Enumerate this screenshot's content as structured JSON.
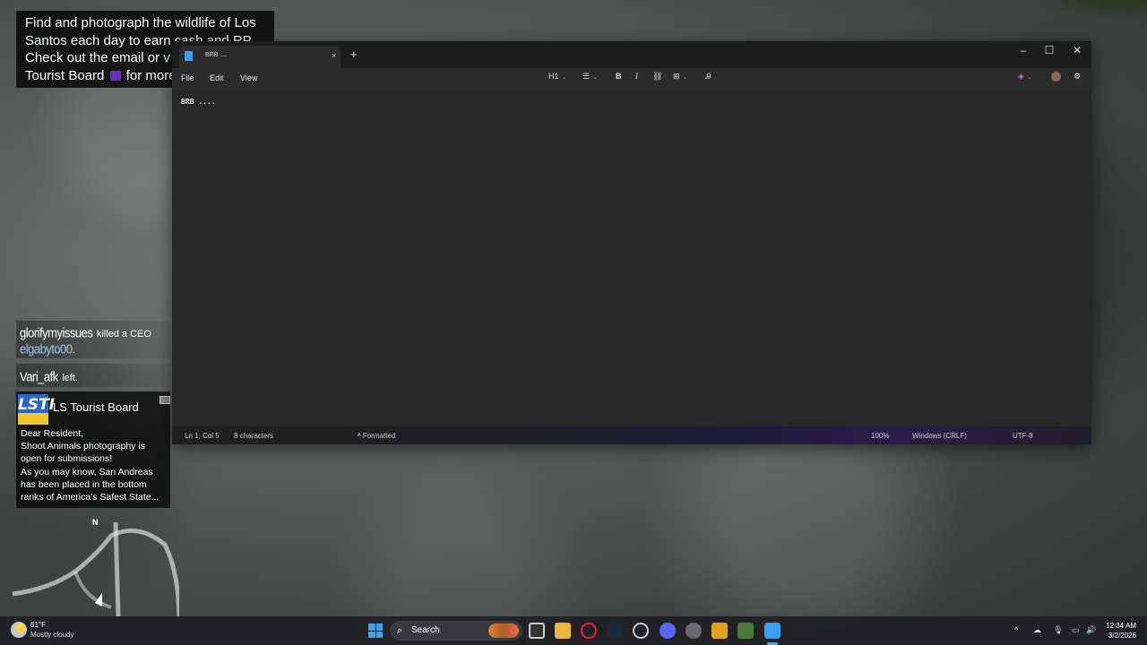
{
  "game": {
    "mission_text": {
      "line1": "Find and photograph the wildlife of Los",
      "line2": "Santos each day to earn cash and RP.",
      "line3": "Check out the email or v",
      "line4a": "Tourist Board",
      "line4b": "for more"
    },
    "feed": [
      {
        "player": "glorifymyissues",
        "action": "killed a CEO"
      },
      {
        "player": "elgabyto00",
        "action": "."
      },
      {
        "player": "Vari_afk",
        "action": "left."
      }
    ],
    "notification": {
      "logo_text": "LSTI",
      "sender": "LS Tourist Board",
      "body": "Dear Resident,\nShoot Animals photography is open for submissions!\nAs you may know, San Andreas has been placed in the bottom ranks of America's Safest State..."
    },
    "minimap": {
      "north_label": "N"
    }
  },
  "notepad": {
    "tab_title": "BRB ....",
    "tab_close": "×",
    "tab_add": "+",
    "menu": [
      "File",
      "Edit",
      "View"
    ],
    "toolbar": {
      "heading": "H1",
      "bold": "B",
      "italic": "I"
    },
    "content": "BRB ....",
    "status": {
      "position": "Ln 1, Col 5",
      "chars": "8 characters",
      "mode": "Formatted",
      "zoom": "100%",
      "line_ending": "Windows (CRLF)",
      "encoding": "UTF-8"
    },
    "window_controls": {
      "minimize": "–",
      "maximize": "☐",
      "close": "✕"
    }
  },
  "taskbar": {
    "weather": {
      "temp": "61°F",
      "desc": "Mostly cloudy"
    },
    "search_label": "Search",
    "clock": {
      "time": "12:34 AM",
      "date": "3/2/2026"
    }
  },
  "colors": {
    "accent": "#3aa3f0",
    "notepad_bg": "#272727",
    "statusbar_purple": "#2a1c4a"
  }
}
